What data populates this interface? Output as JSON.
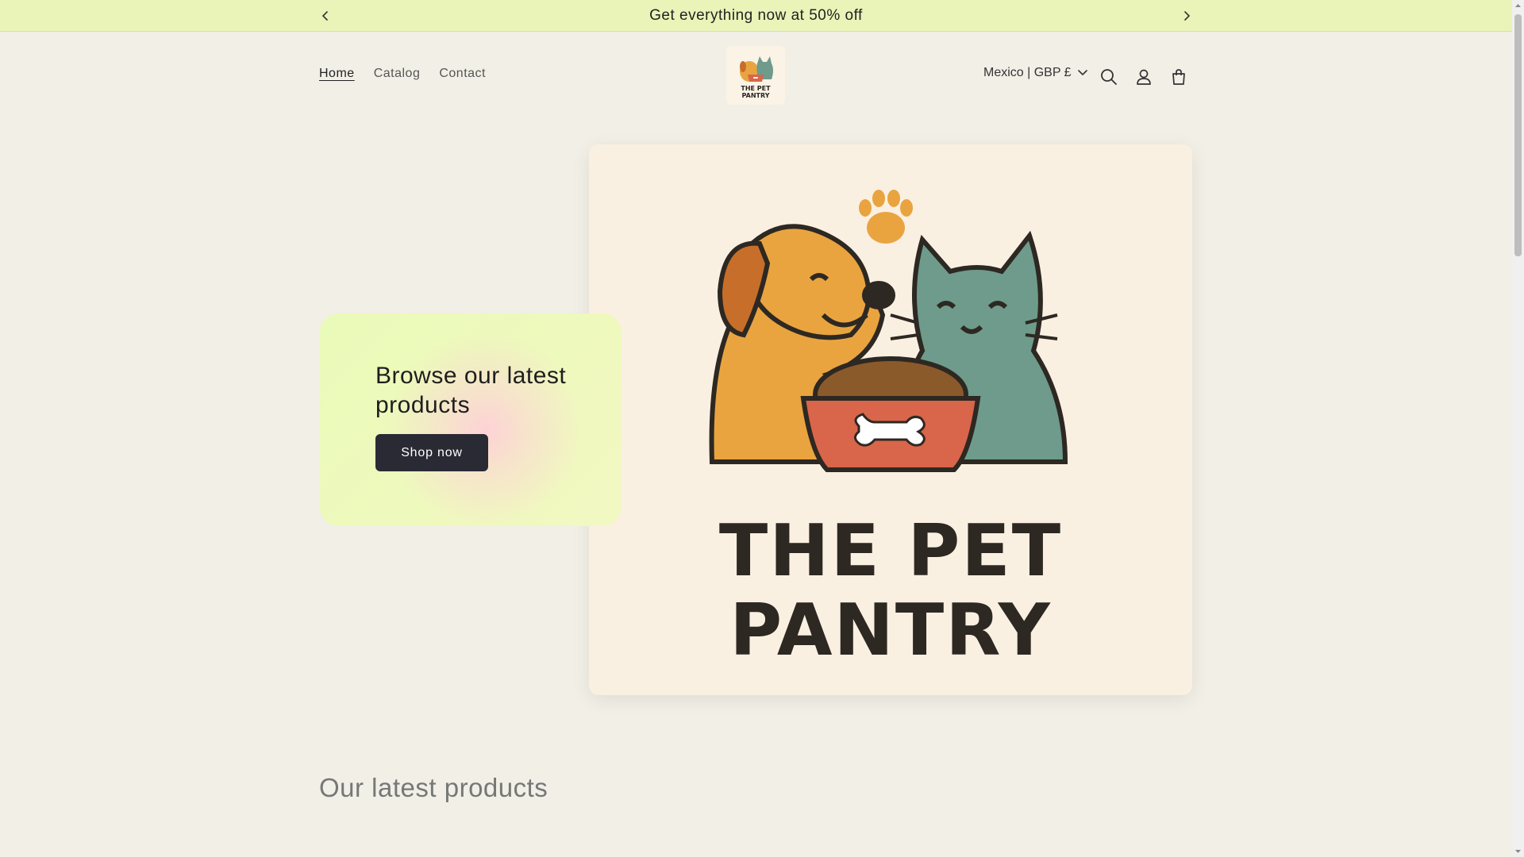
{
  "announcement": {
    "text": "Get everything now at 50% off",
    "prev_icon": "chevron-left-icon",
    "next_icon": "chevron-right-icon"
  },
  "nav": {
    "items": [
      {
        "label": "Home",
        "active": true
      },
      {
        "label": "Catalog",
        "active": false
      },
      {
        "label": "Contact",
        "active": false
      }
    ]
  },
  "logo": {
    "line1": "THE PET",
    "line2": "PANTRY"
  },
  "header": {
    "country_label": "Mexico | GBP £",
    "search_icon": "search-icon",
    "account_icon": "account-icon",
    "cart_icon": "cart-icon"
  },
  "hero": {
    "heading": "Browse our latest products",
    "button_label": "Shop now",
    "image_title_line1": "THE PET",
    "image_title_line2": "PANTRY"
  },
  "section": {
    "title": "Our latest products"
  },
  "colors": {
    "announcement_bg": "#eaf3b8",
    "page_bg": "#f1efe6",
    "button_bg": "#2a2a35",
    "dog_orange": "#e9a440",
    "cat_teal": "#6e9b8c",
    "bowl_red": "#d9654a"
  }
}
